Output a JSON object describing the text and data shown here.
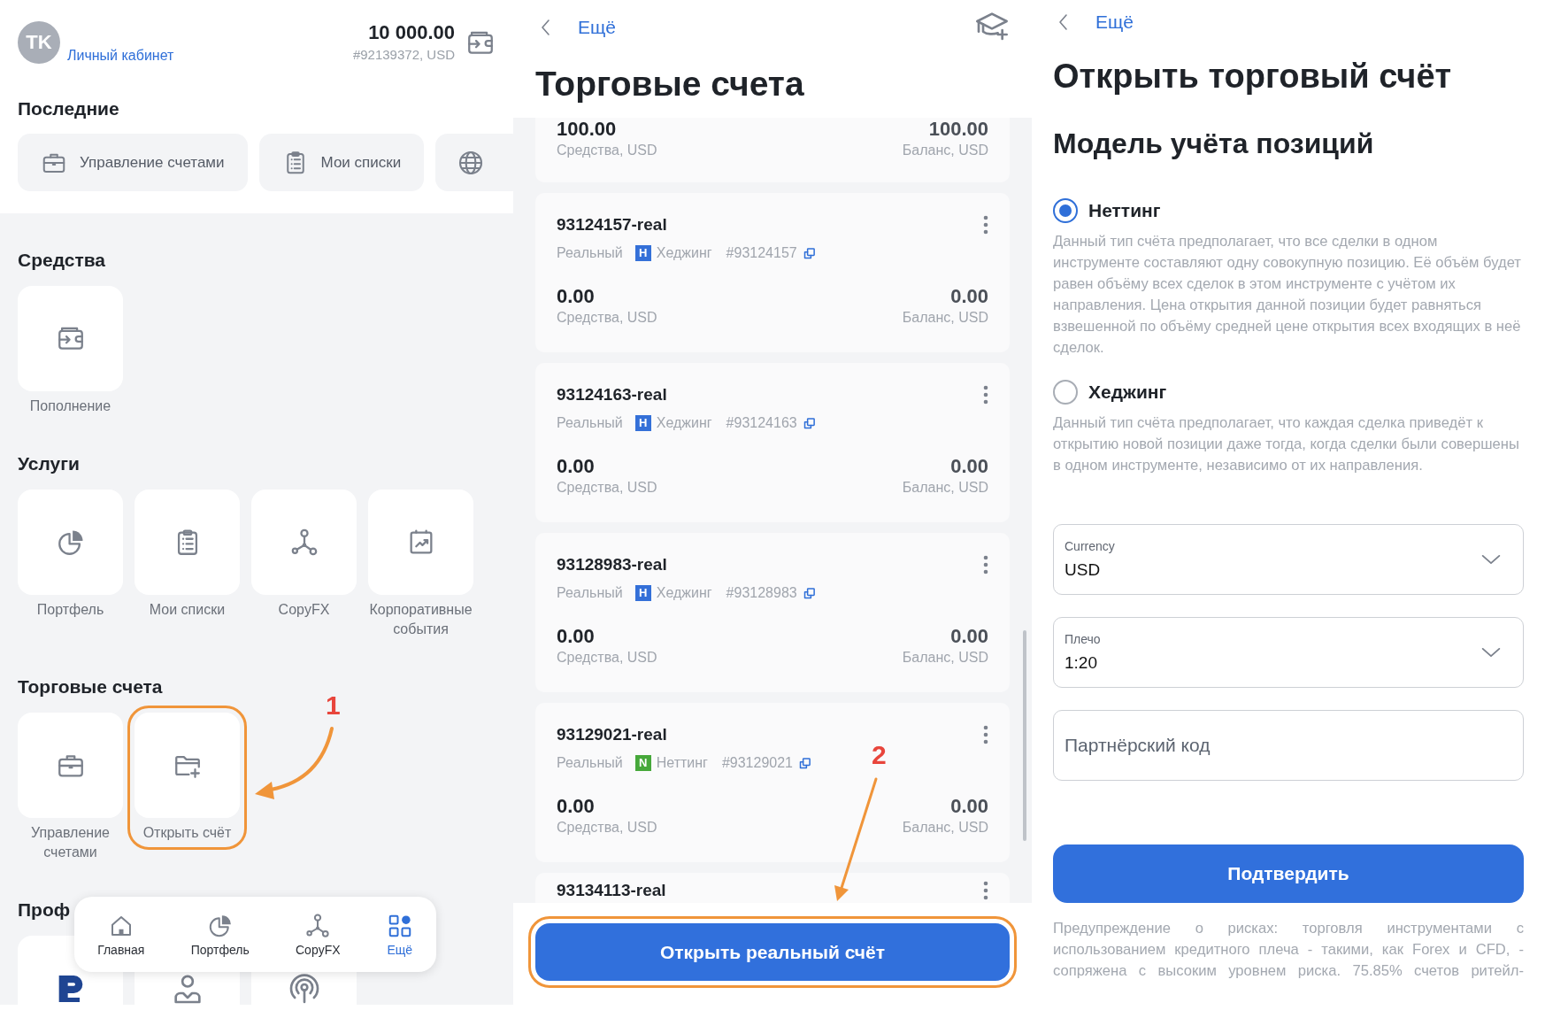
{
  "home": {
    "avatar": "TK",
    "profile_link": "Личный кабинет",
    "balance": "10 000.00",
    "account": "#92139372, USD",
    "recent_title": "Последние",
    "recent": [
      {
        "kind": "labeled",
        "label": "Управление счетами"
      },
      {
        "kind": "labeled",
        "label": "Мои списки"
      },
      {
        "kind": "icon"
      }
    ],
    "sections": [
      {
        "title": "Средства",
        "tiles": [
          {
            "kind": "labeled",
            "label": "Пополнение"
          }
        ]
      },
      {
        "title": "Услуги",
        "tiles": [
          {
            "kind": "labeled",
            "label": "Портфель"
          },
          {
            "kind": "labeled",
            "label": "Мои списки"
          },
          {
            "kind": "labeled",
            "label": "CopyFX"
          },
          {
            "kind": "labeled",
            "label": "Корпоративные события"
          }
        ]
      },
      {
        "title": "Торговые счета",
        "tiles": [
          {
            "kind": "labeled",
            "label": "Управление счетами",
            "highlighted": false
          },
          {
            "kind": "labeled",
            "label": "Открыть счёт",
            "highlighted": true
          }
        ]
      },
      {
        "title": "Проф",
        "tiles": [
          {
            "kind": "icon"
          },
          {
            "kind": "icon"
          },
          {
            "kind": "icon"
          }
        ]
      }
    ],
    "nav": [
      {
        "label": "Главная",
        "selected": false
      },
      {
        "label": "Портфель",
        "selected": false
      },
      {
        "label": "CopyFX",
        "selected": false
      },
      {
        "label": "Ещё",
        "selected": true
      }
    ],
    "annotation": "1"
  },
  "accounts": {
    "back": "Ещё",
    "title": "Торговые счета",
    "items": [
      {
        "kind": "partial",
        "funds": "100.00",
        "funds_label": "Средства, USD",
        "balance": "100.00",
        "balance_label": "Баланс, USD"
      },
      {
        "kind": "full",
        "name": "93124157-real",
        "type": "Реальный",
        "badge": "H",
        "color": "#3470d8",
        "mode": "Хеджинг",
        "number": "#93124157",
        "funds": "0.00",
        "funds_label": "Средства, USD",
        "balance": "0.00",
        "balance_label": "Баланс, USD"
      },
      {
        "kind": "full",
        "name": "93124163-real",
        "type": "Реальный",
        "badge": "H",
        "color": "#3470d8",
        "mode": "Хеджинг",
        "number": "#93124163",
        "funds": "0.00",
        "funds_label": "Средства, USD",
        "balance": "0.00",
        "balance_label": "Баланс, USD"
      },
      {
        "kind": "full",
        "name": "93128983-real",
        "type": "Реальный",
        "badge": "H",
        "color": "#3470d8",
        "mode": "Хеджинг",
        "number": "#93128983",
        "funds": "0.00",
        "funds_label": "Средства, USD",
        "balance": "0.00",
        "balance_label": "Баланс, USD"
      },
      {
        "kind": "full",
        "name": "93129021-real",
        "type": "Реальный",
        "badge": "N",
        "color": "#46a83a",
        "mode": "Неттинг",
        "number": "#93129021",
        "funds": "0.00",
        "funds_label": "Средства, USD",
        "balance": "0.00",
        "balance_label": "Баланс, USD"
      },
      {
        "kind": "cut",
        "name": "93134113-real"
      }
    ],
    "open_button": {
      "label": "Открыть реальный счёт",
      "highlighted": true
    },
    "annotation": "2"
  },
  "open_account": {
    "back": "Ещё",
    "title": "Открыть торговый счёт",
    "subtitle": "Модель учёта позиций",
    "options": [
      {
        "label": "Неттинг",
        "selected": true,
        "description": "Данный тип счёта предполагает, что все сделки в одном инструменте составляют одну совокупную позицию. Её объём будет равен объёму всех сделок в этом инструменте с учётом их направления. Цена открытия данной позиции будет равняться взвешенной по объёму средней цене открытия всех входящих в неё сделок."
      },
      {
        "label": "Хеджинг",
        "selected": false,
        "description": "Данный тип счёта предполагает, что каждая сделка приведёт к открытию новой позиции даже тогда, когда сделки были совершены в одном инструменте, независимо от их направления."
      }
    ],
    "fields": [
      {
        "kind": "select",
        "label": "Currency",
        "value": "USD"
      },
      {
        "kind": "select",
        "label": "Плечо",
        "value": "1:20"
      },
      {
        "kind": "input",
        "placeholder": "Партнёрский код"
      }
    ],
    "confirm": "Подтвердить",
    "warning": "Предупреждение о рисках: торговля инструментами с использованием кредитного плеча - такими, как Forex и CFD, - сопряжена с высоким уровнем риска. 75.85% счетов ритейл-"
  }
}
